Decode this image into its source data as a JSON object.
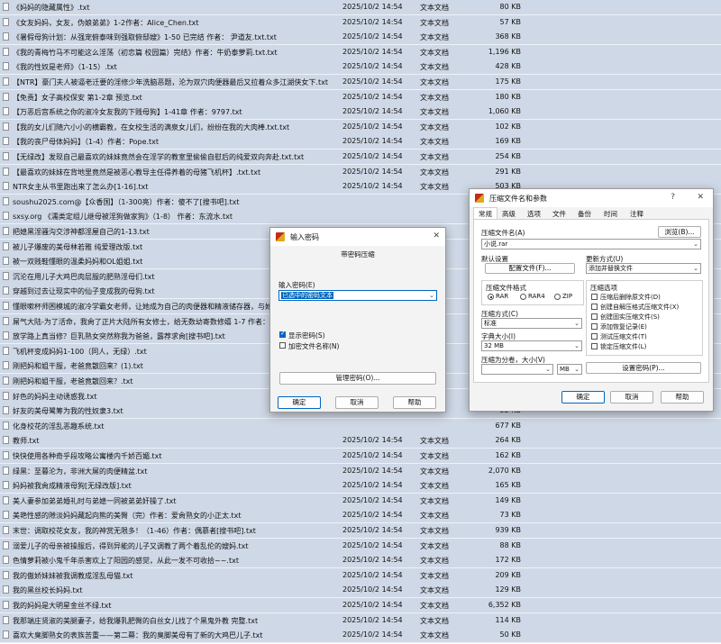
{
  "files": [
    {
      "name": "《妈妈的隐藏属性》.txt",
      "date": "2025/10/2 14:54",
      "type": "文本文档",
      "size": "80 KB"
    },
    {
      "name": "《女友妈妈，女友，伪娘弟弟》1-2作者：Alice_Chen.txt",
      "date": "2025/10/2 14:54",
      "type": "文本文档",
      "size": "57 KB"
    },
    {
      "name": "《暑假母狗计划：从强宠俯泰味到强取俯邸嫂》1-50 已完结 作者： 尹道友.txt.txt",
      "date": "2025/10/2 14:54",
      "type": "文本文档",
      "size": "368 KB"
    },
    {
      "name": "《我的青梅竹马不可能这么淫荡（初恋篇 校园篇）完结》作者：牛奶泰萝莉.txt.txt",
      "date": "2025/10/2 14:54",
      "type": "文本文档",
      "size": "1,196 KB"
    },
    {
      "name": "《我的性奴是老师》（1-15）.txt",
      "date": "2025/10/2 14:54",
      "type": "文本文档",
      "size": "428 KB"
    },
    {
      "name": "【NTR】豪门夫人被逼老迁要的淫修少年洗脑恶题，沦为双穴肉便器最后又拉着众多江湖侠女下.txt",
      "date": "2025/10/2 14:54",
      "type": "文本文档",
      "size": "175 KB"
    },
    {
      "name": "【免责】女子高校保安 第1-2章 预览.txt",
      "date": "2025/10/2 14:54",
      "type": "文本文档",
      "size": "180 KB"
    },
    {
      "name": "【万恶后宫系统之你的淑冷女友我的下贱母狗】1-41章 作者：9797.txt",
      "date": "2025/10/2 14:54",
      "type": "文本文档",
      "size": "1,060 KB"
    },
    {
      "name": "【我的女儿们随六小小的横霸教，在女校生活的满泉女儿们，纷纷在我的大肉棒.txt.txt",
      "date": "2025/10/2 14:54",
      "type": "文本文档",
      "size": "102 KB"
    },
    {
      "name": "【我的丧尸母体妈妈】（1-4）作者：Pope.txt",
      "date": "2025/10/2 14:54",
      "type": "文本文档",
      "size": "169 KB"
    },
    {
      "name": "【无绿改】发现自己最喜欢的妹妹竟然会在淫学的教室里偷偷自慰后的纯爱双向奔赴.txt.txt",
      "date": "2025/10/2 14:54",
      "type": "文本文档",
      "size": "254 KB"
    },
    {
      "name": "【最喜欢的妹妹在背地里竟然是被恶心教导主任得养着的母猪飞机杯】.txt.txt",
      "date": "2025/10/2 14:54",
      "type": "文本文档",
      "size": "291 KB"
    },
    {
      "name": "NTR女主从书里跑出来了怎么办[1-16].txt",
      "date": "2025/10/2 14:54",
      "type": "文本文档",
      "size": "503 KB"
    },
    {
      "name": "soushu2025.com@【众香国】（1-300亮）作者：傻不了[搜书吧].txt",
      "date": "",
      "type": "",
      "size": ""
    },
    {
      "name": "sxsy.org 《濡类定组儿继母被淫狗做家狗》（1-8） 作者：东流水.txt",
      "date": "",
      "type": "",
      "size": ""
    },
    {
      "name": "把媳黑淫骚沟交涉神都淫屋自己的1-13.txt",
      "date": "",
      "type": "",
      "size": ""
    },
    {
      "name": "被儿子爆废的美母林若雅 纯爱理改版.txt",
      "date": "",
      "type": "",
      "size": ""
    },
    {
      "name": "被一双贱鞋懂眼的温柔妈妈和OL姐姐.txt",
      "date": "",
      "type": "",
      "size": ""
    },
    {
      "name": "沉沦在用儿子大鸡巴肉层服的肥熟淫母们.txt",
      "date": "",
      "type": "",
      "size": ""
    },
    {
      "name": "穿越到过去让现实中的仙子变成我的母狗.txt",
      "date": "",
      "type": "",
      "size": ""
    },
    {
      "name": "懂眼嗽杯师困模城的淑冷学霸女老师，让她成为自己的肉便器和精液储存器，与她玉足高跟丝袜.txt",
      "date": "",
      "type": "",
      "size": ""
    },
    {
      "name": "屌气大陆-为了活命，我肏了正片大陆所有女修士，给无数幼寄数修嬉 1-7 作者：岳子.txt.txt",
      "date": "",
      "type": "",
      "size": ""
    },
    {
      "name": "放学路上真当修？巨乳熟女突然称我为爸爸，露荐求肏[搜书吧].txt",
      "date": "",
      "type": "",
      "size": ""
    },
    {
      "name": "飞机杯变成妈妈1-100（同人，无绿）.txt",
      "date": "",
      "type": "",
      "size": ""
    },
    {
      "name": "刚把妈和姐干服，老爸竟散回来？(1).txt",
      "date": "",
      "type": "",
      "size": ""
    },
    {
      "name": "刚把妈和姐干服，老爸竟散回来？.txt",
      "date": "",
      "type": "",
      "size": ""
    },
    {
      "name": "好色的妈妈主动诱惑我.txt",
      "date": "",
      "type": "",
      "size": ""
    },
    {
      "name": "好友的美母鹭筹为我的性奴隶3.txt",
      "date": "",
      "type": "",
      "size": "32 KB"
    },
    {
      "name": "化身校花的淫乱恶趣系统.txt",
      "date": "",
      "type": "",
      "size": "677 KB"
    },
    {
      "name": "教师.txt",
      "date": "2025/10/2 14:54",
      "type": "文本文档",
      "size": "264 KB"
    },
    {
      "name": "快快使用各种奇乎段攻略公寓楼内千娇百媚.txt",
      "date": "2025/10/2 14:54",
      "type": "文本文档",
      "size": "162 KB"
    },
    {
      "name": "绿黑：至暮沦为，非洲大屌的肉便精盆.txt",
      "date": "2025/10/2 14:54",
      "type": "文本文档",
      "size": "2,070 KB"
    },
    {
      "name": "妈妈被我肏成精液母狗[无绿改版].txt",
      "date": "2025/10/2 14:54",
      "type": "文本文档",
      "size": "165 KB"
    },
    {
      "name": "美人妻参加弟弟婚礼时与弟媳一同被弟弟奸操了.txt",
      "date": "2025/10/2 14:54",
      "type": "文本文档",
      "size": "149 KB"
    },
    {
      "name": "美艳性感的隙淡妈妈藏起向熊的美臀（完）作者：爱肏熟女的小正太.txt",
      "date": "2025/10/2 14:54",
      "type": "文本文档",
      "size": "73 KB"
    },
    {
      "name": "末世：调取校花女友，我的神赏无限多！（1-46）作者：偶慕者[搜书吧].txt",
      "date": "2025/10/2 14:54",
      "type": "文本文档",
      "size": "939 KB"
    },
    {
      "name": "溺爱儿子的母亲被操服后，得到异能的儿子又调教了两个着乱伦的嫂妈.txt",
      "date": "2025/10/2 14:54",
      "type": "文本文档",
      "size": "88 KB"
    },
    {
      "name": "色情萝莉被小鬼千年杀害欢上了阳园的感觉，从此一发不可收拾~~.txt",
      "date": "2025/10/2 14:54",
      "type": "文本文档",
      "size": "172 KB"
    },
    {
      "name": "我的傲娇妹妹被我调教成淫乱母猫.txt",
      "date": "2025/10/2 14:54",
      "type": "文本文档",
      "size": "209 KB"
    },
    {
      "name": "我的黑丝校长妈妈.txt",
      "date": "2025/10/2 14:54",
      "type": "文本文档",
      "size": "129 KB"
    },
    {
      "name": "我的妈妈是大明星金丝不绿.txt",
      "date": "2025/10/2 14:54",
      "type": "文本文档",
      "size": "6,352 KB"
    },
    {
      "name": "我那端庄贤淑的美腿妻子，给我爆乳肥臀的白丝女儿找了个黑鬼外教 完整.txt",
      "date": "2025/10/2 14:54",
      "type": "文本文档",
      "size": "114 KB"
    },
    {
      "name": "喜欢大臭脚熟女的表族苦重——第二幕：我的臭脚美母有了新的大鸡巴儿子.txt",
      "date": "2025/10/2 14:54",
      "type": "文本文档",
      "size": "50 KB"
    }
  ],
  "pwd_dialog": {
    "title": "输入密码",
    "heading": "带密码压缩",
    "label": "输入密码(E)",
    "value": "已选中的密码文本",
    "show_pwd": "显示密码(S)",
    "encrypt_names": "加密文件名称(N)",
    "manage": "管理密码(O)...",
    "ok": "确定",
    "cancel": "取消",
    "help": "帮助"
  },
  "arc_dialog": {
    "title": "压缩文件名和参数",
    "help_glyph": "?",
    "close_glyph": "✕",
    "tabs": [
      "常规",
      "高级",
      "选项",
      "文件",
      "备份",
      "时间",
      "注释"
    ],
    "name_label": "压缩文件名(A)",
    "browse": "浏览(B)...",
    "name_value": "小说.rar",
    "default_label": "默认设置",
    "profiles": "配置文件(F)...",
    "update_label": "更新方式(U)",
    "update_value": "添加并替换文件",
    "format_label": "压缩文件格式",
    "formats": [
      "RAR",
      "RAR4",
      "ZIP"
    ],
    "method_label": "压缩方式(C)",
    "method_value": "标准",
    "dict_label": "字典大小(I)",
    "dict_value": "32 MB",
    "split_label": "压缩为分卷，大小(V)",
    "split_unit": "MB",
    "options_label": "压缩选项",
    "options": [
      "压缩后删除原文件(D)",
      "创建自解压格式压缩文件(X)",
      "创建固实压缩文件(S)",
      "添加恢复记录(E)",
      "测试压缩文件(T)",
      "锁定压缩文件(L)"
    ],
    "set_pwd": "设置密码(P)...",
    "ok": "确定",
    "cancel": "取消",
    "help": "帮助"
  }
}
